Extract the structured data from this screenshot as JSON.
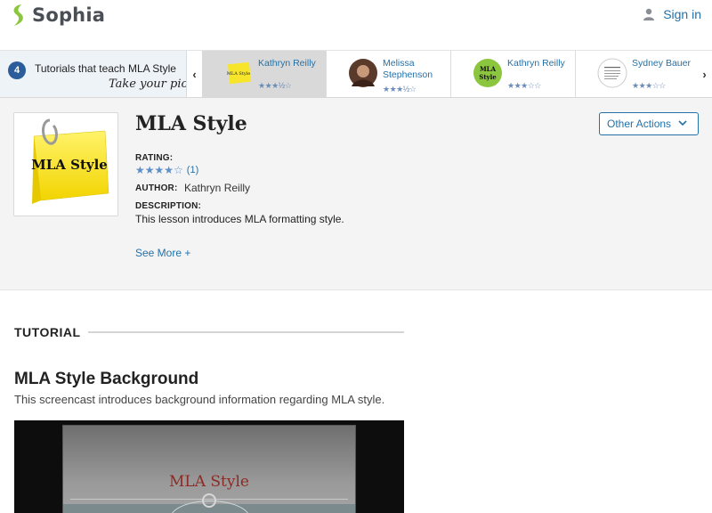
{
  "header": {
    "logo_text": "Sophia",
    "signin_label": "Sign in"
  },
  "tutorials_strip": {
    "count": "4",
    "intro": "Tutorials that teach MLA Style",
    "pick": "Take your pick:",
    "cards": [
      {
        "author": "Kathryn Reilly",
        "rating": 3.5,
        "thumb_text": "MLA Style"
      },
      {
        "author": "Melissa Stephenson",
        "rating": 3.5,
        "thumb_text": ""
      },
      {
        "author": "Kathryn Reilly",
        "rating": 3,
        "thumb_text": "MLA Style"
      },
      {
        "author": "Sydney Bauer",
        "rating": 3,
        "thumb_text": ""
      }
    ]
  },
  "lesson": {
    "thumb_text": "MLA Style",
    "title": "MLA Style",
    "rating_label": "RATING:",
    "rating_stars": "★★★★☆",
    "rating_value": 4,
    "rating_count": "(1)",
    "author_label": "AUTHOR:",
    "author": "Kathryn Reilly",
    "description_label": "DESCRIPTION:",
    "description": "This lesson introduces MLA formatting style.",
    "see_more": "See More +",
    "other_actions": "Other Actions"
  },
  "tutorial": {
    "section_label": "TUTORIAL",
    "title": "MLA Style Background",
    "description": "This screencast introduces background information regarding MLA style.",
    "video_slide_title": "MLA Style"
  },
  "colors": {
    "link": "#2371a8",
    "logo_green": "#8cc63f",
    "badge": "#2a5d9a",
    "star": "#5b8fc7"
  }
}
